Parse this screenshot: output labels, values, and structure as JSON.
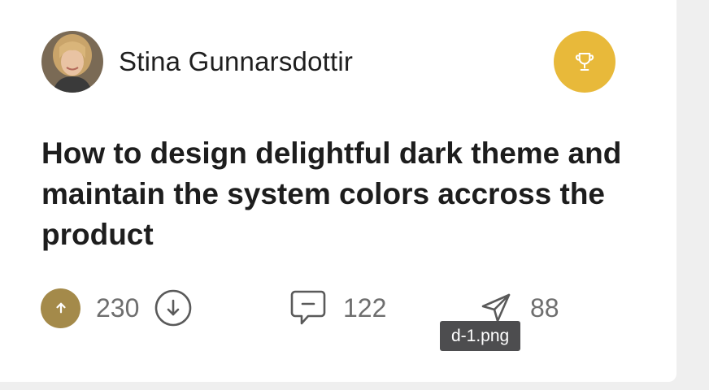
{
  "card": {
    "author": {
      "name": "Stina Gunnarsdottir",
      "avatar_icon": "avatar-photo"
    },
    "award_icon": "trophy-icon",
    "colors": {
      "award_bg": "#e8b93a",
      "upvote_bg": "#a48a4a",
      "text": "#1d1d1d",
      "muted": "#6e6e6e"
    },
    "title": "How to design delightful dark theme and maintain the system colors accross the product",
    "stats": {
      "upvotes": "230",
      "comments": "122",
      "shares": "88"
    }
  },
  "tooltip": {
    "text": "d-1.png"
  }
}
